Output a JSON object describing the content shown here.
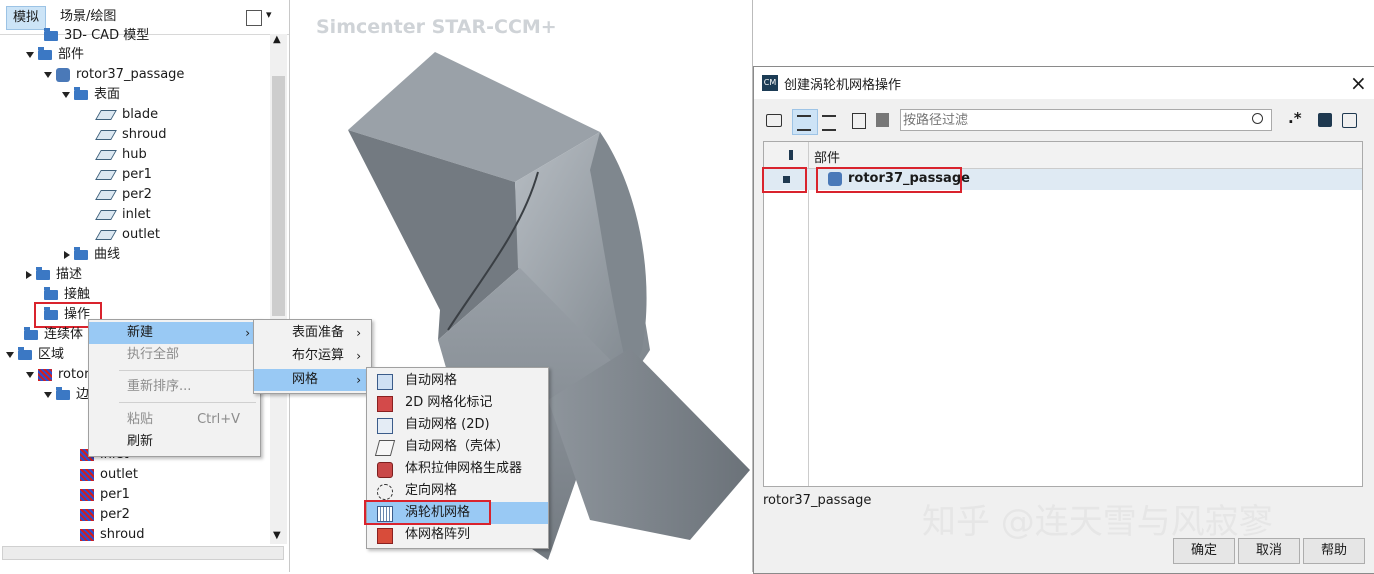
{
  "left_panel": {
    "tabs": [
      "模拟",
      "场景/绘图"
    ],
    "tree": [
      {
        "label": "3D- CAD 模型"
      },
      {
        "label": "部件"
      },
      {
        "label": "rotor37_passage"
      },
      {
        "label": "表面"
      },
      {
        "label": "blade"
      },
      {
        "label": "shroud"
      },
      {
        "label": "hub"
      },
      {
        "label": "per1"
      },
      {
        "label": "per2"
      },
      {
        "label": "inlet"
      },
      {
        "label": "outlet"
      },
      {
        "label": "曲线"
      },
      {
        "label": "描述"
      },
      {
        "label": "接触"
      },
      {
        "label": "操作"
      },
      {
        "label": "连续体"
      },
      {
        "label": "区域"
      },
      {
        "label": "rotor"
      },
      {
        "label": "边"
      },
      {
        "label": "inlet"
      },
      {
        "label": "outlet"
      },
      {
        "label": "per1"
      },
      {
        "label": "per2"
      },
      {
        "label": "shroud"
      }
    ]
  },
  "viewport": {
    "watermark": "Simcenter STAR-CCM+"
  },
  "context_menu_1": {
    "items": [
      "新建",
      "执行全部",
      "重新排序...",
      "粘贴",
      "刷新"
    ],
    "shortcut_paste": "Ctrl+V",
    "arrow": "›"
  },
  "context_menu_2": {
    "items": [
      "表面准备",
      "布尔运算",
      "网格"
    ],
    "arrow": "›"
  },
  "context_menu_3": {
    "items": [
      "自动网格",
      "2D 网格化标记",
      "自动网格 (2D)",
      "自动网格（壳体）",
      "体积拉伸网格生成器",
      "定向网格",
      "涡轮机网格",
      "体网格阵列"
    ]
  },
  "dialog": {
    "title_icon": "CM",
    "title": "创建涡轮机网格操作",
    "close": "×",
    "filter_placeholder": "按路径过滤",
    "regex_label": ".*",
    "column_header": "部件",
    "row_part": "rotor37_passage",
    "status_text": "rotor37_passage",
    "buttons": {
      "ok": "确定",
      "cancel": "取消",
      "help": "帮助"
    }
  },
  "watermark_zhihu": "知乎 @连天雪与风寂寥",
  "colors": {
    "highlight": "#99c9f4",
    "selection_box": "#d9232d",
    "tab_active": "#cce4f7",
    "model_gray": "#8d949b"
  }
}
